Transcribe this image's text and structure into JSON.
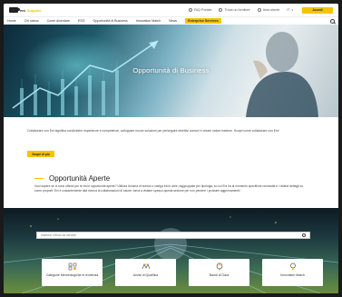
{
  "topbar": {
    "brand": "eni",
    "brand_suffix": "Supplier",
    "utility_items": [
      {
        "label": "FAQ Portale",
        "icon": "info-icon"
      },
      {
        "label": "Trova un fornitore",
        "icon": "person-icon"
      },
      {
        "label": "Area utente",
        "icon": "user-icon"
      },
      {
        "label": "IT",
        "icon": "chevron-down-icon"
      }
    ],
    "cta_label": "Accedi"
  },
  "nav": {
    "items": [
      {
        "label": "Home",
        "active": false
      },
      {
        "label": "Chi siamo",
        "active": false
      },
      {
        "label": "Come diventare",
        "active": false
      },
      {
        "label": "ESG",
        "active": false
      },
      {
        "label": "Opportunità di Business",
        "active": false
      },
      {
        "label": "Innovation Match",
        "active": false
      },
      {
        "label": "News",
        "active": false
      },
      {
        "label": "Enterprise Services",
        "active": true
      }
    ]
  },
  "hero": {
    "title": "Opportunità di Business"
  },
  "intro": {
    "text": "Collaborare con Eni significa condividere esperienze e competenze, sviluppare nuove soluzioni per perseguire obiettivi comuni e creare valore insieme. Scopri come collaborare con Eni!",
    "button_label": "Scopri di più"
  },
  "section": {
    "title": "Opportunità Aperte",
    "text": "Vuoi sapere se ci sono offerte per te tra le opportunità aperte? Utilizza la barra di ricerca o naviga tra le aree, raggruppate per tipologia, su cui Eni ha al momento specifiche necessità e i relativi dettagli su come proporti. Eni è costantemente alla ricerca di collaborazioni di valore: torna a visitare spesso questa sezione per non perdere i prossimi aggiornamenti!"
  },
  "search": {
    "placeholder": "Inserisci il testo da cercare"
  },
  "cards": [
    {
      "label": "Categorie Merceologiche in evidenza",
      "icon": "categories-icon"
    },
    {
      "label": "Avvisi di Qualifica",
      "icon": "qualification-icon"
    },
    {
      "label": "Bandi di Gara",
      "icon": "tender-icon"
    },
    {
      "label": "Innovation Match",
      "icon": "lightbulb-icon"
    }
  ],
  "colors": {
    "accent": "#f5c400",
    "text": "#222222"
  }
}
